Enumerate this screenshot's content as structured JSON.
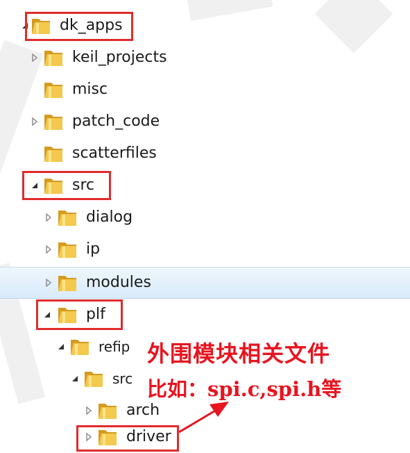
{
  "tree": {
    "items": [
      {
        "label": "dk_apps"
      },
      {
        "label": "keil_projects"
      },
      {
        "label": "misc"
      },
      {
        "label": "patch_code"
      },
      {
        "label": "scatterfiles"
      },
      {
        "label": "src"
      },
      {
        "label": "dialog"
      },
      {
        "label": "ip"
      },
      {
        "label": "modules"
      },
      {
        "label": "plf"
      },
      {
        "label": "refip"
      },
      {
        "label": "src"
      },
      {
        "label": "arch"
      },
      {
        "label": "driver"
      }
    ]
  },
  "annotation": {
    "line1": "外围模块相关文件",
    "line2": "比如：spi.c,spi.h等"
  },
  "colors": {
    "highlight": "#e02b2b",
    "annotation": "#e8141f",
    "hover_row": "#d9ebfb",
    "folder": "#e8b73a"
  },
  "icons": {
    "folder": "folder-icon",
    "expanded": "triangle-expanded-icon",
    "collapsed": "triangle-collapsed-icon"
  }
}
